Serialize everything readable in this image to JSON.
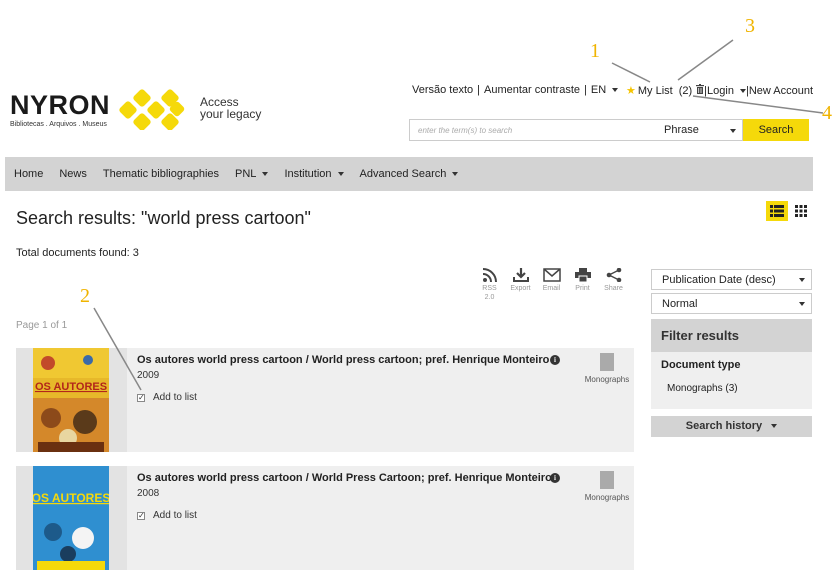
{
  "annotations": [
    "1",
    "2",
    "3",
    "4"
  ],
  "brand": {
    "name": "NYRON",
    "subtitle": "Bibliotecas . Arquivos . Museus",
    "tagline_line1": "Access",
    "tagline_line2": "your legacy",
    "accent_color": "#f5d90a"
  },
  "top_links": {
    "text_version": "Versão texto",
    "contrast": "Aumentar contraste",
    "language": "EN",
    "my_list": "My List",
    "list_count": "(2)",
    "trash_icon": "trash-icon",
    "login": "Login",
    "new_account": "New Account"
  },
  "search": {
    "placeholder": "enter the term(s) to search",
    "type": "Phrase",
    "button": "Search"
  },
  "nav": {
    "home": "Home",
    "news": "News",
    "thematic": "Thematic bibliographies",
    "pnl": "PNL",
    "institution": "Institution",
    "advanced": "Advanced Search"
  },
  "results_page": {
    "title": "Search results: \"world press cartoon\"",
    "total": "Total documents found: 3",
    "page_info": "Page 1 of 1"
  },
  "actions": {
    "rss": "RSS",
    "rss_version": "2.0",
    "export": "Export",
    "email": "Email",
    "print": "Print",
    "share": "Share"
  },
  "results": [
    {
      "title": "Os autores world press cartoon / World press cartoon; pref. Henrique Monteiro",
      "year": "2009",
      "add_label": "Add to list",
      "checked": true,
      "doc_type": "Monographs",
      "info_glyph": "i"
    },
    {
      "title": "Os autores world press cartoon / World Press Cartoon; pref. Henrique Monteiro",
      "year": "2008",
      "add_label": "Add to list",
      "checked": true,
      "doc_type": "Monographs",
      "info_glyph": "i"
    }
  ],
  "sidebar": {
    "sort": "Publication Date (desc)",
    "view_mode": "Normal",
    "filter_title": "Filter results",
    "doc_type_heading": "Document type",
    "doc_type_item": "Monographs",
    "doc_type_count": "(3)",
    "history": "Search history"
  }
}
